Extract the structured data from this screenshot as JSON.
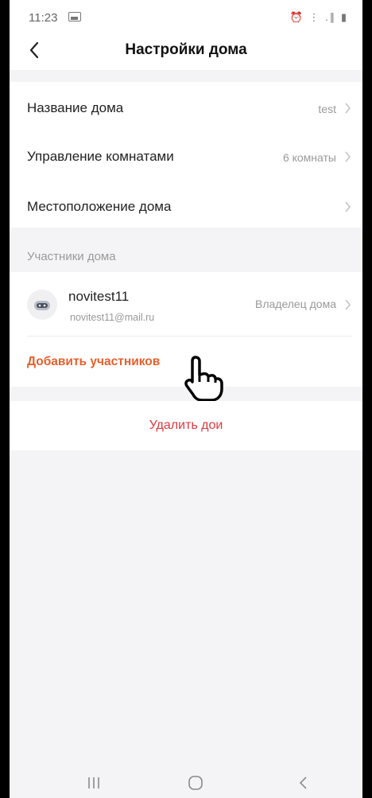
{
  "status_bar": {
    "time": "11:23",
    "image_icon": "image-icon",
    "right_icons": "⏰ ⋮ .∥ ▮"
  },
  "header": {
    "title": "Настройки дома",
    "back_icon": "back-chevron-icon"
  },
  "settings": [
    {
      "label": "Название дома",
      "value": "test"
    },
    {
      "label": "Управление комнатами",
      "value": "6 комнаты"
    },
    {
      "label": "Местоположение дома",
      "value": ""
    }
  ],
  "members_section": {
    "title": "Участники дома",
    "members": [
      {
        "name": "novitest11",
        "email": "novitest11@mail.ru",
        "role": "Владелец дома",
        "avatar_icon": "robot-avatar-icon"
      }
    ],
    "add_label": "Добавить участников"
  },
  "delete_label": "Удалить дои",
  "colors": {
    "accent": "#e6602d",
    "danger": "#e0383f",
    "background": "#f4f4f6"
  },
  "nav_bar": {
    "recents_icon": "recents-icon",
    "home_icon": "home-icon",
    "back_icon": "nav-back-icon"
  }
}
